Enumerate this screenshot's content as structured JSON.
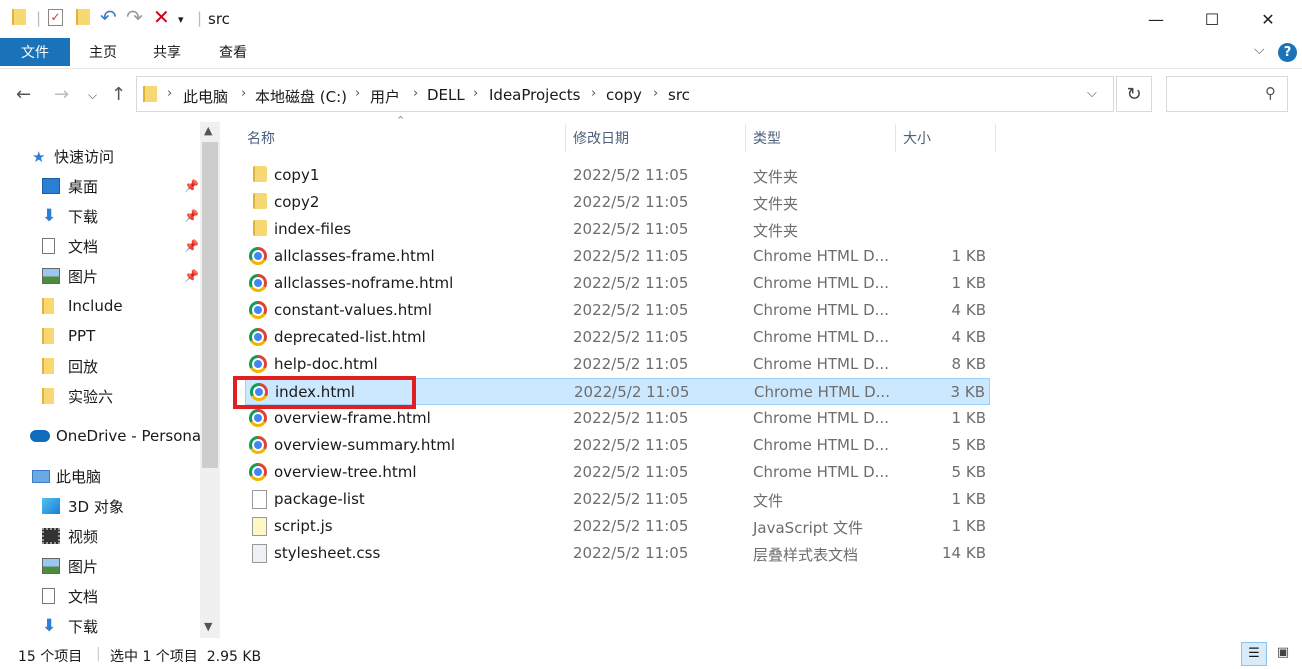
{
  "window": {
    "title": "src",
    "minimize": "—",
    "maximize": "☐",
    "close": "✕"
  },
  "ribbon": {
    "tabs": [
      {
        "label": "文件"
      },
      {
        "label": "主页"
      },
      {
        "label": "共享"
      },
      {
        "label": "查看"
      }
    ]
  },
  "address": {
    "crumbs": [
      "此电脑",
      "本地磁盘 (C:)",
      "用户",
      "DELL",
      "IdeaProjects",
      "copy",
      "src"
    ],
    "search_placeholder": ""
  },
  "sidebar": {
    "quick_access": "快速访问",
    "items": [
      {
        "label": "桌面",
        "icon": "desktop-icon",
        "pinned": true
      },
      {
        "label": "下载",
        "icon": "download-icon",
        "pinned": true
      },
      {
        "label": "文档",
        "icon": "documents-icon",
        "pinned": true
      },
      {
        "label": "图片",
        "icon": "pictures-icon",
        "pinned": true
      },
      {
        "label": "Include",
        "icon": "folder-icon",
        "pinned": false
      },
      {
        "label": "PPT",
        "icon": "folder-icon",
        "pinned": false
      },
      {
        "label": "回放",
        "icon": "folder-icon",
        "pinned": false
      },
      {
        "label": "实验六",
        "icon": "folder-icon",
        "pinned": false
      }
    ],
    "onedrive": "OneDrive - Personal",
    "this_pc": "此电脑",
    "pc_items": [
      {
        "label": "3D 对象",
        "icon": "3d-objects-icon"
      },
      {
        "label": "视频",
        "icon": "video-icon"
      },
      {
        "label": "图片",
        "icon": "pictures-icon"
      },
      {
        "label": "文档",
        "icon": "documents-icon"
      },
      {
        "label": "下载",
        "icon": "download-icon"
      }
    ]
  },
  "columns": {
    "name": "名称",
    "date": "修改日期",
    "type": "类型",
    "size": "大小"
  },
  "files": [
    {
      "name": "copy1",
      "date": "2022/5/2 11:05",
      "type": "文件夹",
      "size": "",
      "icon": "folder-icon"
    },
    {
      "name": "copy2",
      "date": "2022/5/2 11:05",
      "type": "文件夹",
      "size": "",
      "icon": "folder-icon"
    },
    {
      "name": "index-files",
      "date": "2022/5/2 11:05",
      "type": "文件夹",
      "size": "",
      "icon": "folder-icon"
    },
    {
      "name": "allclasses-frame.html",
      "date": "2022/5/2 11:05",
      "type": "Chrome HTML D...",
      "size": "1 KB",
      "icon": "chrome-icon"
    },
    {
      "name": "allclasses-noframe.html",
      "date": "2022/5/2 11:05",
      "type": "Chrome HTML D...",
      "size": "1 KB",
      "icon": "chrome-icon"
    },
    {
      "name": "constant-values.html",
      "date": "2022/5/2 11:05",
      "type": "Chrome HTML D...",
      "size": "4 KB",
      "icon": "chrome-icon"
    },
    {
      "name": "deprecated-list.html",
      "date": "2022/5/2 11:05",
      "type": "Chrome HTML D...",
      "size": "4 KB",
      "icon": "chrome-icon"
    },
    {
      "name": "help-doc.html",
      "date": "2022/5/2 11:05",
      "type": "Chrome HTML D...",
      "size": "8 KB",
      "icon": "chrome-icon"
    },
    {
      "name": "index.html",
      "date": "2022/5/2 11:05",
      "type": "Chrome HTML D...",
      "size": "3 KB",
      "icon": "chrome-icon",
      "selected": true
    },
    {
      "name": "overview-frame.html",
      "date": "2022/5/2 11:05",
      "type": "Chrome HTML D...",
      "size": "1 KB",
      "icon": "chrome-icon"
    },
    {
      "name": "overview-summary.html",
      "date": "2022/5/2 11:05",
      "type": "Chrome HTML D...",
      "size": "5 KB",
      "icon": "chrome-icon"
    },
    {
      "name": "overview-tree.html",
      "date": "2022/5/2 11:05",
      "type": "Chrome HTML D...",
      "size": "5 KB",
      "icon": "chrome-icon"
    },
    {
      "name": "package-list",
      "date": "2022/5/2 11:05",
      "type": "文件",
      "size": "1 KB",
      "icon": "file-icon"
    },
    {
      "name": "script.js",
      "date": "2022/5/2 11:05",
      "type": "JavaScript 文件",
      "size": "1 KB",
      "icon": "js-file-icon"
    },
    {
      "name": "stylesheet.css",
      "date": "2022/5/2 11:05",
      "type": "层叠样式表文档",
      "size": "14 KB",
      "icon": "css-file-icon"
    }
  ],
  "status": {
    "count": "15 个项目",
    "selection": "选中 1 个项目  2.95 KB"
  },
  "colors": {
    "accent": "#1a73b8",
    "selection": "#cce8ff",
    "highlight_box": "#e02020"
  }
}
